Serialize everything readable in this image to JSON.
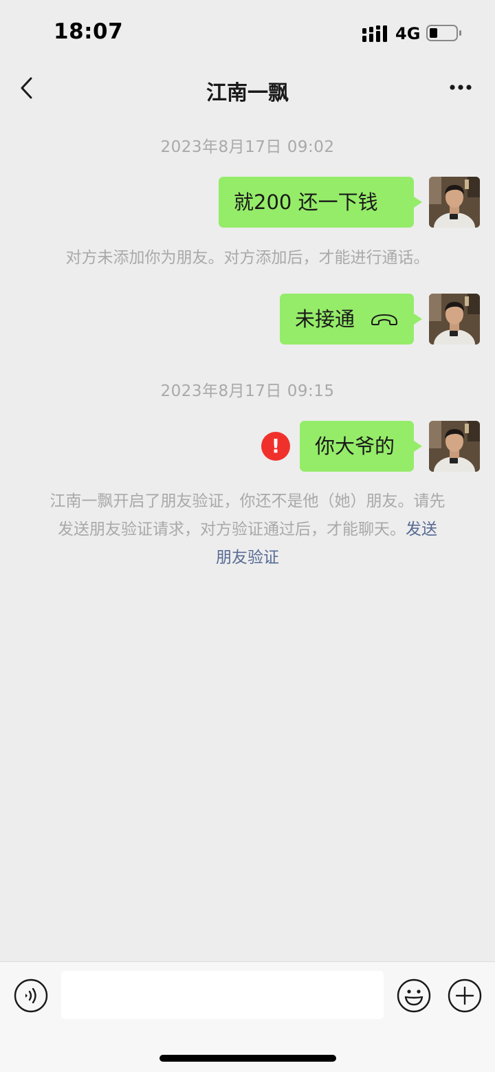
{
  "status_bar": {
    "time": "18:07",
    "network": "4G",
    "icons": [
      "signal-icon",
      "battery-icon"
    ]
  },
  "nav": {
    "title": "江南一飘",
    "back_icon": "chevron-left-icon",
    "more_icon": "more-dots-icon"
  },
  "chat": {
    "timestamp_1": "2023年8月17日 09:02",
    "msg_1": "就200  还一下钱",
    "system_1": "对方未添加你为朋友。对方添加后，才能进行通话。",
    "msg_2": "未接通",
    "msg_2_icon": "hang-up-phone-icon",
    "timestamp_2": "2023年8月17日 09:15",
    "msg_3": "你大爷的",
    "msg_3_status_icon": "send-failed-error-icon",
    "msg_3_error_glyph": "!",
    "system_2_line_1": "江南一飘开启了朋友验证，你还不是他（她）朋友。请先",
    "system_2_line_2": "发送朋友验证请求，对方验证通过后，才能聊天。",
    "system_2_link_part_1": "发送",
    "system_2_link_part_2": "朋友验证"
  },
  "input_bar": {
    "voice_icon": "voice-input-icon",
    "emoji_icon": "emoji-icon",
    "plus_icon": "plus-icon",
    "input_value": ""
  },
  "colors": {
    "background": "#ededed",
    "bubble": "#95ec69",
    "link": "#576b95",
    "error": "#f0312b"
  }
}
